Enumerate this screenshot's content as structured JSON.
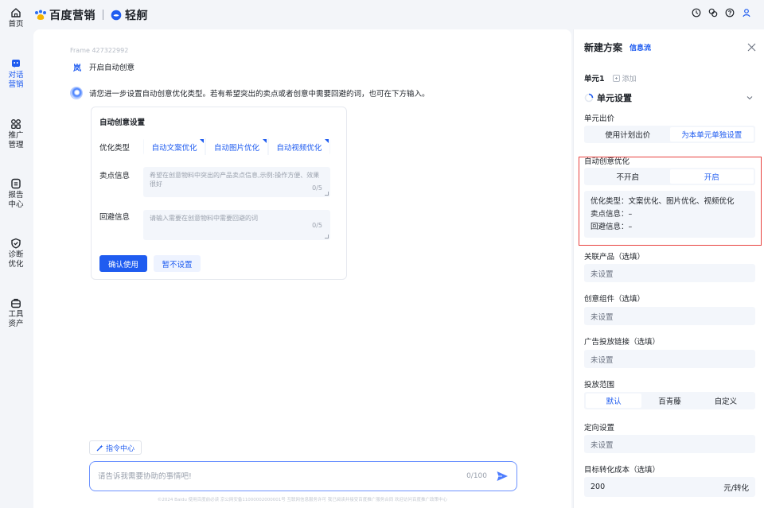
{
  "brand": {
    "logo_text": "百度营销",
    "product_text": "轻舸"
  },
  "nav": [
    {
      "label": "首页",
      "icon": "home-icon"
    },
    {
      "label": "对话营销",
      "icon": "chat-icon"
    },
    {
      "label": "推广管理",
      "icon": "grid-icon"
    },
    {
      "label": "报告中心",
      "icon": "report-icon"
    },
    {
      "label": "诊断优化",
      "icon": "shield-icon"
    },
    {
      "label": "工具资产",
      "icon": "toolbox-icon"
    }
  ],
  "top_icons": [
    "clock-icon",
    "copy-icon",
    "help-icon",
    "user-icon"
  ],
  "conversation": {
    "frame_label": "Frame 427322992",
    "user_avatar": "岚",
    "user_message": "开启自动创意",
    "bot_message": "请您进一步设置自动创意优化类型。若有希望突出的卖点或者创意中需要回避的词，也可在下方输入。"
  },
  "creative_card": {
    "title": "自动创意设置",
    "optimize_label": "优化类型",
    "options": [
      "自动文案优化",
      "自动图片优化",
      "自动视频优化"
    ],
    "selling_label": "卖点信息",
    "selling_placeholder": "希望在创意物料中突出的产品卖点信息,示例:操作方便、效果很好",
    "selling_count": "0/5",
    "avoid_label": "回避信息",
    "avoid_placeholder": "请输入需要在创意物料中需要回避的词",
    "avoid_count": "0/5",
    "confirm_button": "确认使用",
    "skip_button": "暂不设置"
  },
  "chat": {
    "command_center": "指令中心",
    "placeholder": "请告诉我需要协助的事情吧!",
    "count": "0/100",
    "footer": "©2024 Baidu 使用百度前必读 京公网安备11000002000001号 互联网信息服务许可 我已阅读并接受百度推广服务合同 欢迎访问百度推广政策中心"
  },
  "panel": {
    "title": "新建方案",
    "tag": "信息流",
    "unit_name": "单元1",
    "add_label": "添加",
    "unit_settings": "单元设置",
    "bid_label": "单元出价",
    "bid_options": [
      "使用计划出价",
      "为本单元单独设置"
    ],
    "auto_label": "自动创意优化",
    "auto_options": [
      "不开启",
      "开启"
    ],
    "summary_type": "优化类型：文案优化、图片优化、视频优化",
    "summary_selling": "卖点信息：–",
    "summary_avoid": "回避信息：–",
    "product_label": "关联产品（选填）",
    "product_value": "未设置",
    "component_label": "创意组件（选填）",
    "component_value": "未设置",
    "link_label": "广告投放链接（选填）",
    "link_value": "未设置",
    "range_label": "投放范围",
    "range_options": [
      "默认",
      "百青藤",
      "自定义"
    ],
    "target_label": "定向设置",
    "target_value": "未设置",
    "cost_label": "目标转化成本（选填）",
    "cost_value": "200",
    "cost_unit": "元/转化"
  },
  "colors": {
    "accent": "#1f5cf0",
    "highlight": "#e8423f"
  }
}
